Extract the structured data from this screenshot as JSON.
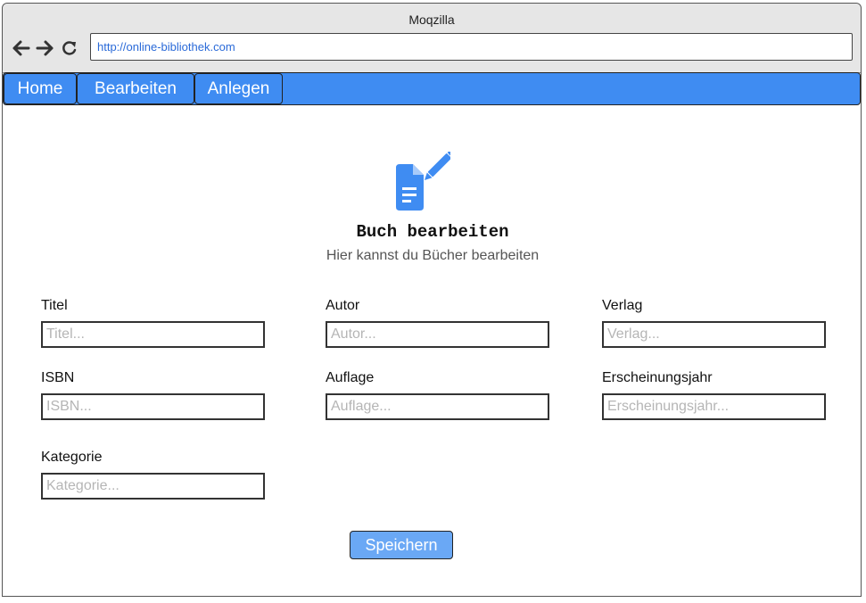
{
  "browser": {
    "title": "Moqzilla",
    "url": "http://online-bibliothek.com",
    "nav_icons": [
      "back-arrow-icon",
      "forward-arrow-icon",
      "reload-icon"
    ]
  },
  "menu": {
    "items": [
      {
        "label": "Home"
      },
      {
        "label": "Bearbeiten"
      },
      {
        "label": "Anlegen"
      }
    ]
  },
  "header": {
    "icon": "edit-document-icon",
    "title": "Buch bearbeiten",
    "subtitle": "Hier kannst du Bücher bearbeiten"
  },
  "form": {
    "titel": {
      "label": "Titel",
      "placeholder": "Titel..."
    },
    "autor": {
      "label": "Autor",
      "placeholder": "Autor..."
    },
    "verlag": {
      "label": "Verlag",
      "placeholder": "Verlag..."
    },
    "isbn": {
      "label": "ISBN",
      "placeholder": "ISBN..."
    },
    "auflage": {
      "label": "Auflage",
      "placeholder": "Auflage..."
    },
    "erscheinungsjahr": {
      "label": "Erscheinungsjahr",
      "placeholder": "Erscheinungsjahr..."
    },
    "kategorie": {
      "label": "Kategorie",
      "placeholder": "Kategorie..."
    },
    "save_label": "Speichern"
  },
  "colors": {
    "accent": "#3f8cf2",
    "button": "#6aa8f5",
    "url_text": "#2a6ad8"
  }
}
